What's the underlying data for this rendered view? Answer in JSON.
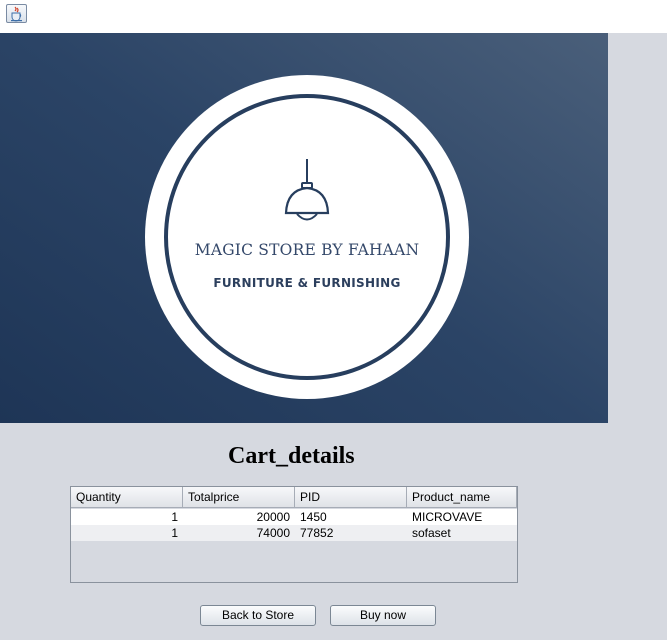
{
  "window": {
    "icon": "java-cup-icon"
  },
  "banner": {
    "logo_icon": "pendant-lamp-icon",
    "store_name": "MAGIC STORE BY FAHAAN",
    "tagline": "FURNITURE & FURNISHING"
  },
  "main": {
    "heading": "Cart_details"
  },
  "cart_table": {
    "columns": [
      "Quantity",
      "Totalprice",
      "PID",
      "Product_name"
    ],
    "rows": [
      [
        "1",
        "20000",
        "1450",
        "MICROVAVE"
      ],
      [
        "1",
        "74000",
        "77852",
        "sofaset"
      ]
    ]
  },
  "buttons": {
    "back": "Back to Store",
    "buy": "Buy now"
  },
  "colors": {
    "banner_dark": "#1e3556",
    "banner_light": "#4a5f7a",
    "logo_ink": "#273e5e",
    "window_bg": "#d6d9e0"
  }
}
